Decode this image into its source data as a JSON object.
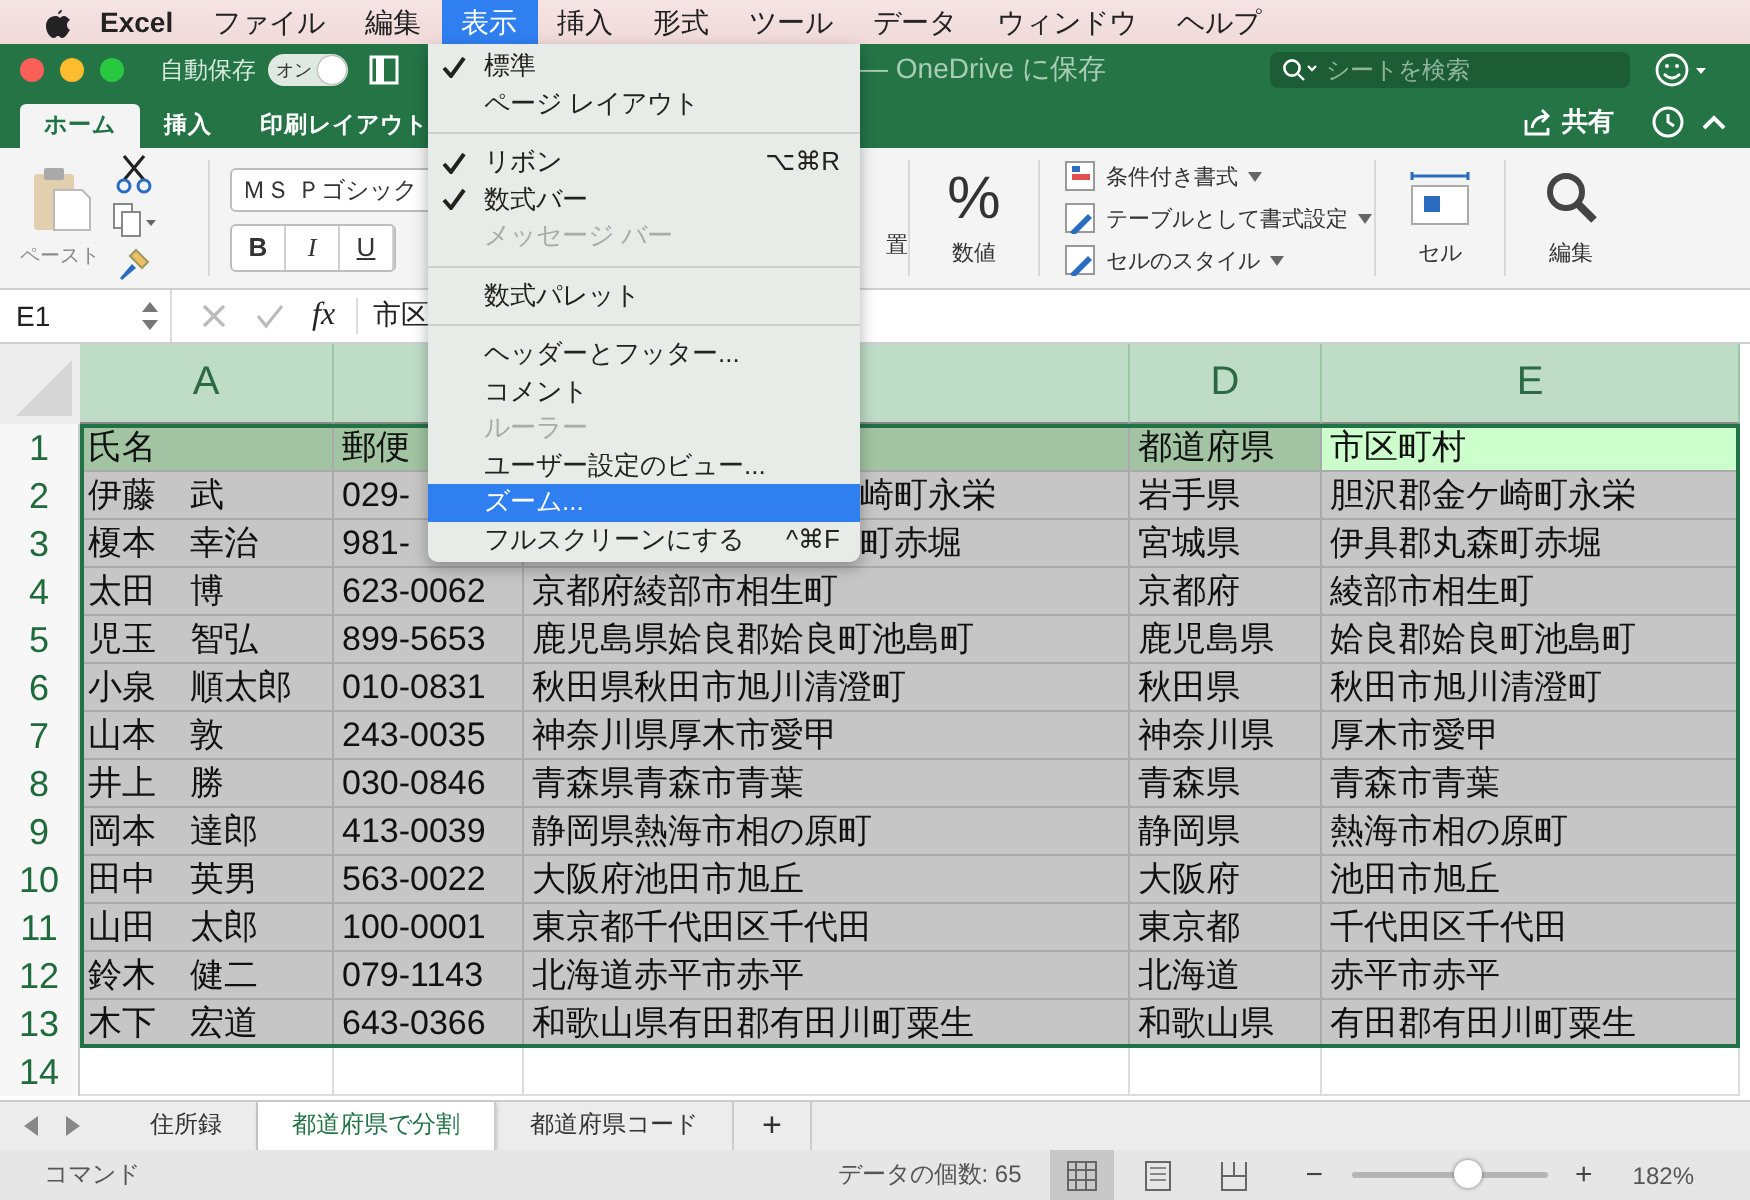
{
  "menubar": {
    "app": "Excel",
    "items": [
      {
        "label": "ファイル",
        "selected": false
      },
      {
        "label": "編集",
        "selected": false
      },
      {
        "label": "表示",
        "selected": true
      },
      {
        "label": "挿入",
        "selected": false
      },
      {
        "label": "形式",
        "selected": false
      },
      {
        "label": "ツール",
        "selected": false
      },
      {
        "label": "データ",
        "selected": false
      },
      {
        "label": "ウィンドウ",
        "selected": false
      },
      {
        "label": "ヘルプ",
        "selected": false
      }
    ]
  },
  "titlebar": {
    "autosave_label": "自動保存",
    "autosave_toggle": {
      "label": "オン",
      "on": true
    },
    "title": "— OneDrive に保存",
    "search": {
      "placeholder": "シートを検索"
    }
  },
  "ribbon_tabs": [
    {
      "label": "ホーム",
      "selected": true
    },
    {
      "label": "挿入",
      "selected": false
    },
    {
      "label": "印刷レイアウト",
      "selected": false
    }
  ],
  "share": "共有",
  "ribbon": {
    "paste": "ペースト",
    "font": "ＭＳ Ｐゴシック",
    "bold": "B",
    "italic": "I",
    "underline": "U",
    "alignment_label": "置",
    "number_symbol": "%",
    "number_label": "数値",
    "styles": [
      "条件付き書式",
      "テーブルとして書式設定",
      "セルのスタイル"
    ],
    "cells": "セル",
    "editing": "編集"
  },
  "formula_bar": {
    "name_box": "E1",
    "fx": "fx",
    "content": "市区"
  },
  "grid": {
    "columns": [
      {
        "label": "A"
      },
      {},
      {},
      {
        "label": "D"
      },
      {
        "label": "E"
      }
    ],
    "rows": [
      {
        "number": "1",
        "kind": "header",
        "cells": [
          {
            "text": "氏名",
            "selected": false
          },
          {
            "text": "郵便",
            "selected": false
          },
          {
            "selected": false
          },
          {
            "text": "都道府県",
            "selected": false
          },
          {
            "text": "市区町村",
            "selected": true
          }
        ]
      },
      {
        "number": "2",
        "kind": "data",
        "cells": [
          "伊藤　武",
          "029-",
          null,
          "岩手県",
          "胆沢郡金ケ崎町永栄"
        ],
        "c_visible": "崎町永栄"
      },
      {
        "number": "3",
        "kind": "data",
        "cells": [
          "榎本　幸治",
          "981-",
          null,
          "宮城県",
          "伊具郡丸森町赤堀"
        ],
        "c_visible": "町赤堀"
      },
      {
        "number": "4",
        "kind": "data",
        "cells": [
          "太田　博",
          "623-0062",
          "京都府綾部市相生町",
          "京都府",
          "綾部市相生町"
        ]
      },
      {
        "number": "5",
        "kind": "data",
        "cells": [
          "児玉　智弘",
          "899-5653",
          "鹿児島県姶良郡姶良町池島町",
          "鹿児島県",
          "姶良郡姶良町池島町"
        ]
      },
      {
        "number": "6",
        "kind": "data",
        "cells": [
          "小泉　順太郎",
          "010-0831",
          "秋田県秋田市旭川清澄町",
          "秋田県",
          "秋田市旭川清澄町"
        ]
      },
      {
        "number": "7",
        "kind": "data",
        "cells": [
          "山本　敦",
          "243-0035",
          "神奈川県厚木市愛甲",
          "神奈川県",
          "厚木市愛甲"
        ]
      },
      {
        "number": "8",
        "kind": "data",
        "cells": [
          "井上　勝",
          "030-0846",
          "青森県青森市青葉",
          "青森県",
          "青森市青葉"
        ]
      },
      {
        "number": "9",
        "kind": "data",
        "cells": [
          "岡本　達郎",
          "413-0039",
          "静岡県熱海市相の原町",
          "静岡県",
          "熱海市相の原町"
        ]
      },
      {
        "number": "10",
        "kind": "data",
        "cells": [
          "田中　英男",
          "563-0022",
          "大阪府池田市旭丘",
          "大阪府",
          "池田市旭丘"
        ]
      },
      {
        "number": "11",
        "kind": "data",
        "cells": [
          "山田　太郎",
          "100-0001",
          "東京都千代田区千代田",
          "東京都",
          "千代田区千代田"
        ]
      },
      {
        "number": "12",
        "kind": "data",
        "cells": [
          "鈴木　健二",
          "079-1143",
          "北海道赤平市赤平",
          "北海道",
          "赤平市赤平"
        ]
      },
      {
        "number": "13",
        "kind": "data",
        "cells": [
          "木下　宏道",
          "643-0366",
          "和歌山県有田郡有田川町粟生",
          "和歌山県",
          "有田郡有田川町粟生"
        ]
      },
      {
        "number": "14",
        "kind": "empty"
      }
    ]
  },
  "view_menu": {
    "items": [
      {
        "kind": "item",
        "label": "標準",
        "checked": true,
        "disabled": false,
        "selected": false
      },
      {
        "kind": "item",
        "label": "ページ レイアウト",
        "checked": false,
        "disabled": false,
        "selected": false
      },
      {
        "kind": "separator"
      },
      {
        "kind": "item",
        "label": "リボン",
        "checked": true,
        "disabled": false,
        "selected": false,
        "shortcut": "⌥⌘R"
      },
      {
        "kind": "item",
        "label": "数式バー",
        "checked": true,
        "disabled": false,
        "selected": false
      },
      {
        "kind": "item",
        "label": "メッセージ バー",
        "checked": false,
        "disabled": true,
        "selected": false
      },
      {
        "kind": "separator"
      },
      {
        "kind": "item",
        "label": "数式パレット",
        "checked": false,
        "disabled": false,
        "selected": false
      },
      {
        "kind": "separator"
      },
      {
        "kind": "item",
        "label": "ヘッダーとフッター...",
        "checked": false,
        "disabled": false,
        "selected": false
      },
      {
        "kind": "item",
        "label": "コメント",
        "checked": false,
        "disabled": false,
        "selected": false
      },
      {
        "kind": "item",
        "label": "ルーラー",
        "checked": false,
        "disabled": true,
        "selected": false
      },
      {
        "kind": "item",
        "label": "ユーザー設定のビュー...",
        "checked": false,
        "disabled": false,
        "selected": false
      },
      {
        "kind": "item",
        "label": "ズーム...",
        "checked": false,
        "disabled": false,
        "selected": true
      },
      {
        "kind": "item",
        "label": "フルスクリーンにする",
        "checked": false,
        "disabled": false,
        "selected": false,
        "shortcut": "^⌘F"
      }
    ]
  },
  "sheet_tabs": [
    {
      "label": "住所録",
      "selected": false
    },
    {
      "label": "都道府県で分割",
      "selected": true
    },
    {
      "label": "都道府県コード",
      "selected": false
    }
  ],
  "add_sheet": "+",
  "status_bar": {
    "mode": "コマンド",
    "count": "データの個数: 65",
    "views": [
      {
        "kind": "normal",
        "selected": true
      },
      {
        "kind": "page_layout",
        "selected": false
      },
      {
        "kind": "page_break",
        "selected": false
      }
    ],
    "zoom": {
      "minus": "−",
      "plus": "+",
      "level": 0.6,
      "reading": "182%"
    }
  }
}
